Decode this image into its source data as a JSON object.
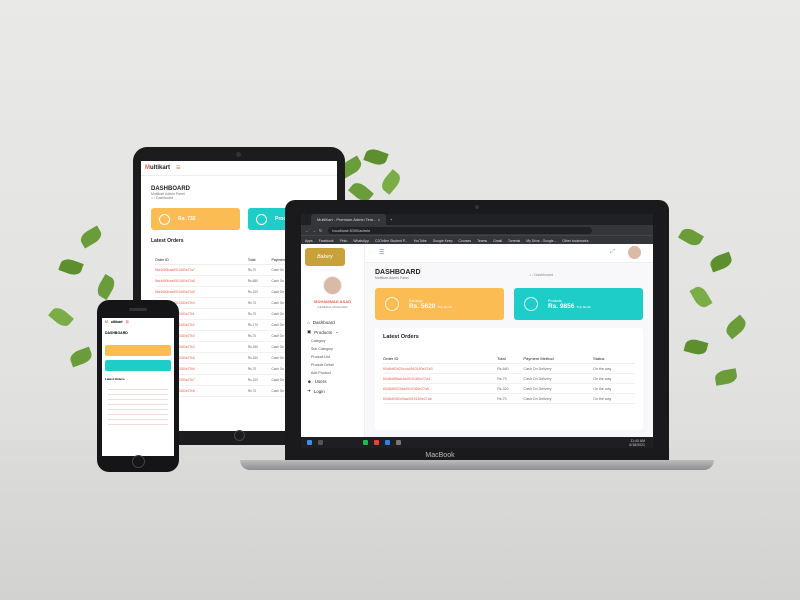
{
  "colors": {
    "accent": "#ef5f53",
    "orange": "#fcbc54",
    "teal": "#1fcdc8"
  },
  "laptop": {
    "brand": "MacBook",
    "browser": {
      "tab_title": "MultiKart - Premium Admin Tem...",
      "url": "localhost:3000/admin",
      "bookmarks": [
        "Apps",
        "Facebook",
        "Pinto",
        "WhatsApp",
        "C2Online Student P...",
        "YouTube",
        "Google Keep",
        "Courses",
        "Teams",
        "Gmail",
        "Torrents",
        "My Drive - Google...",
        "Other bookmarks"
      ]
    },
    "taskbar": {
      "time": "11:40 AM",
      "date": "6/18/2021"
    },
    "sidebar": {
      "user_name": "MOHAMMAD ASAD",
      "user_role": "GENERAL MANAGER",
      "nav": [
        {
          "label": "Dashboard",
          "icon": "home-icon"
        },
        {
          "label": "Products",
          "icon": "box-icon"
        }
      ],
      "sub_items": [
        "Category",
        "Sub Category",
        "Product List",
        "Product Detail",
        "Add Product"
      ],
      "bottom_nav": [
        {
          "label": "Users",
          "icon": "users-icon"
        },
        {
          "label": "Login",
          "icon": "login-icon"
        }
      ]
    },
    "page": {
      "title": "DASHBOARD",
      "subtitle": "Multikart Admin Panel",
      "breadcrumb": "Dashboard"
    },
    "cards": [
      {
        "label": "Earnings",
        "value": "Rs. 5620",
        "period": "This Month"
      },
      {
        "label": "Products",
        "value": "Rs. 9856",
        "period": "This Month"
      }
    ],
    "orders": {
      "title": "Latest Orders",
      "headers": [
        "Order ID",
        "Total",
        "Payment Method",
        "Status"
      ],
      "rows": [
        [
          "60d8d82d20cca4910180e27a3",
          "Rs.640",
          "Cash On Delivery",
          "On the way"
        ],
        [
          "60d8d8f8ab4d4910180e27a4",
          "Rs.70",
          "Cash On Delivery",
          "On the way"
        ],
        [
          "60d8d9023da4910180e27a5",
          "Rs.320",
          "Cash On Delivery",
          "On the way"
        ],
        [
          "60d8d93f2c0aa4910180e27a6",
          "Rs.70",
          "Cash On Delivery",
          "On the way"
        ]
      ]
    }
  },
  "tablet": {
    "logo": "ultikart",
    "title": "DASHBOARD",
    "subtitle": "Multikart Admin Panel",
    "breadcrumb": "Dashboard",
    "cards": [
      {
        "value": "Rs. 732"
      },
      {
        "value": "Products"
      }
    ],
    "orders_title": "Latest Orders",
    "headers": [
      "Order ID",
      "Total",
      "Payment Method"
    ],
    "rows": [
      [
        "5bd4d50fcaa4910180e27a7",
        "Rs.70",
        "Cash On Delivery"
      ],
      [
        "5bd4d50fcaa4910180e27a8",
        "Rs.650",
        "Cash On Delivery"
      ],
      [
        "5bd4d50fcaa4910180e27a9",
        "Rs.320",
        "Cash On Delivery"
      ],
      [
        "5bd4d50fcaa4910180e27b0",
        "Rs.70",
        "Cash On Delivery"
      ],
      [
        "5bd4d50fcaa4910180e27b1",
        "Rs.70",
        "Cash On Delivery"
      ],
      [
        "5bd4d50fcaa4910180e27b2",
        "Rs.170",
        "Cash On Delivery"
      ],
      [
        "5bd4d50fcaa4910180e27b3",
        "Rs.70",
        "Cash On Delivery"
      ],
      [
        "5bd4d50fcaa4910180e27b4",
        "Rs.180",
        "Cash On Delivery"
      ],
      [
        "5bd4d50fcaa4910180e27b5",
        "Rs.160",
        "Cash On Delivery"
      ],
      [
        "5bd4d50fcaa4910180e27b6",
        "Rs.70",
        "Cash On Delivery"
      ],
      [
        "5bd4d50fcaa4910180e27b7",
        "Rs.320",
        "Cash On Delivery"
      ],
      [
        "5bd4d50fcaa4910180e27b8",
        "Rs.70",
        "Cash On Delivery"
      ]
    ]
  },
  "phone": {
    "logo": "ultikart",
    "title": "DASHBOARD",
    "orders_title": "Latest Orders"
  }
}
